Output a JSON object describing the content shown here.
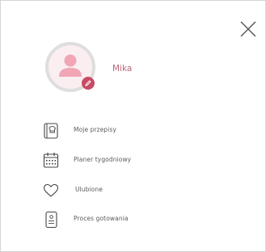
{
  "close": {
    "icon": "close-icon"
  },
  "profile": {
    "name": "Mika",
    "avatar_icon": "user-avatar-icon",
    "edit_icon": "pencil-icon",
    "accent": "#c84a65"
  },
  "menu": {
    "items": [
      {
        "label": "Moje przepisy",
        "icon": "recipe-book-icon"
      },
      {
        "label": "Planer tygodniowy",
        "icon": "calendar-icon"
      },
      {
        "label": "Ulubione",
        "icon": "heart-icon"
      },
      {
        "label": "Proces gotowania",
        "icon": "cooking-process-icon"
      }
    ]
  }
}
